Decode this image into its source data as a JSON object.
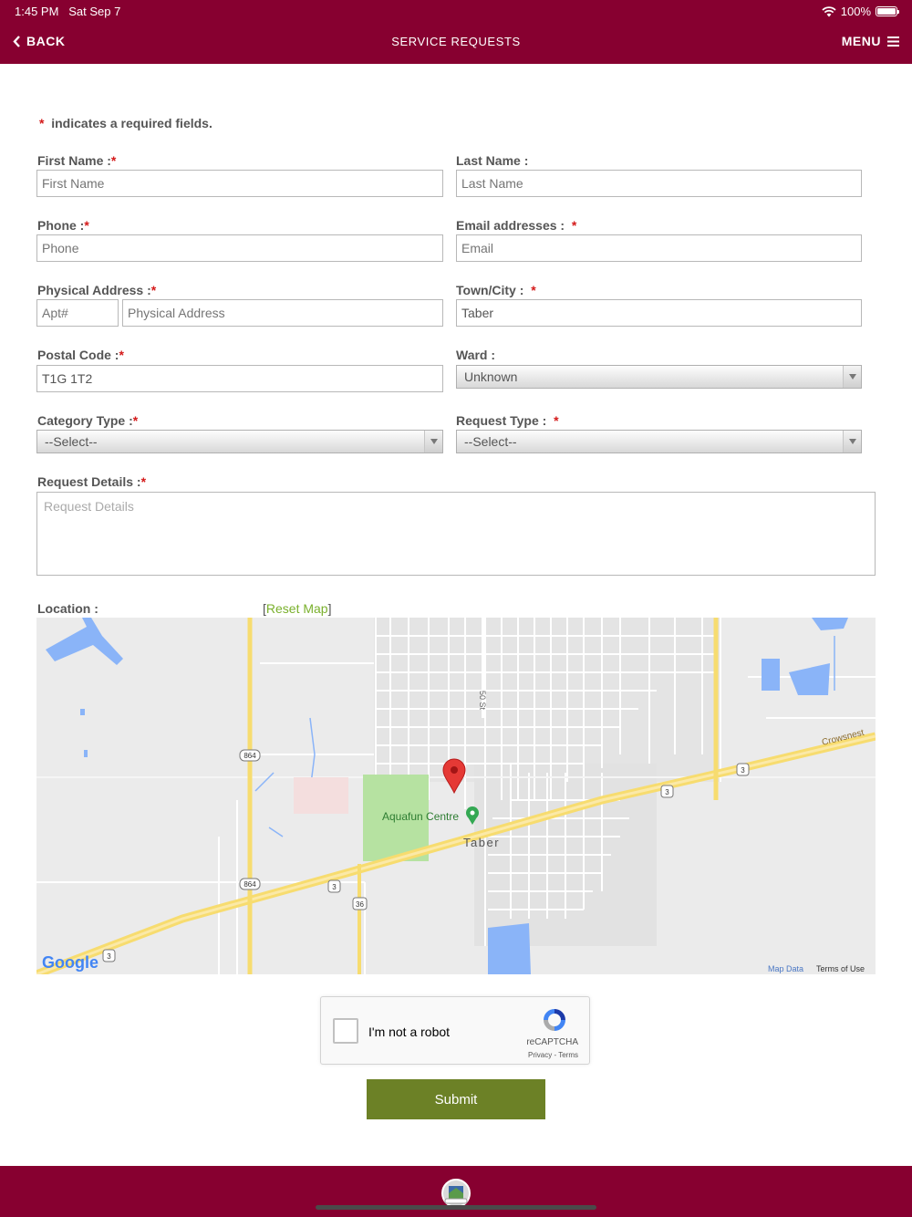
{
  "status": {
    "time": "1:45 PM",
    "date": "Sat Sep 7",
    "battery": "100%",
    "battery_level": 1.0
  },
  "nav": {
    "back": "BACK",
    "title": "SERVICE REQUESTS",
    "menu": "MENU"
  },
  "form": {
    "required_mark": "*",
    "note": "indicates a required fields.",
    "first_name": {
      "label": "First Name :",
      "placeholder": "First Name"
    },
    "last_name": {
      "label": "Last Name :",
      "placeholder": "Last Name"
    },
    "phone": {
      "label": "Phone :",
      "placeholder": "Phone"
    },
    "email": {
      "label": "Email addresses :",
      "placeholder": "Email"
    },
    "address": {
      "label": "Physical Address :",
      "apt_placeholder": "Apt#",
      "placeholder": "Physical Address"
    },
    "town": {
      "label": "Town/City :",
      "value": "Taber"
    },
    "postal": {
      "label": "Postal Code :",
      "value": "T1G 1T2"
    },
    "ward": {
      "label": "Ward :",
      "value": "Unknown"
    },
    "category": {
      "label": "Category Type :",
      "value": "--Select--"
    },
    "request_type": {
      "label": "Request Type :",
      "value": "--Select--"
    },
    "details": {
      "label": "Request Details :",
      "placeholder": "Request Details"
    },
    "location": {
      "label": "Location :",
      "reset_open": "[",
      "reset_label": "Reset Map",
      "reset_close": "]"
    }
  },
  "map": {
    "labels": {
      "street": "50 St",
      "highway": "Crowsnest",
      "place": "Aquafun Centre",
      "town": "Taber",
      "shield_864": "864",
      "shield_3": "3",
      "shield_36": "36",
      "google": "Google",
      "map_data": "Map Data",
      "terms": "Terms of Use"
    },
    "colors": {
      "road_major": "#f7dc6f",
      "park": "#b6e2a1",
      "water": "#8ab4f8",
      "marker": "#e53935"
    }
  },
  "captcha": {
    "label": "I'm not a robot",
    "brand": "reCAPTCHA",
    "links": "Privacy - Terms"
  },
  "submit": {
    "label": "Submit"
  },
  "colors": {
    "brand": "#870030",
    "submit": "#6c8126",
    "required": "#d41a1a",
    "link": "#7ab02c"
  }
}
